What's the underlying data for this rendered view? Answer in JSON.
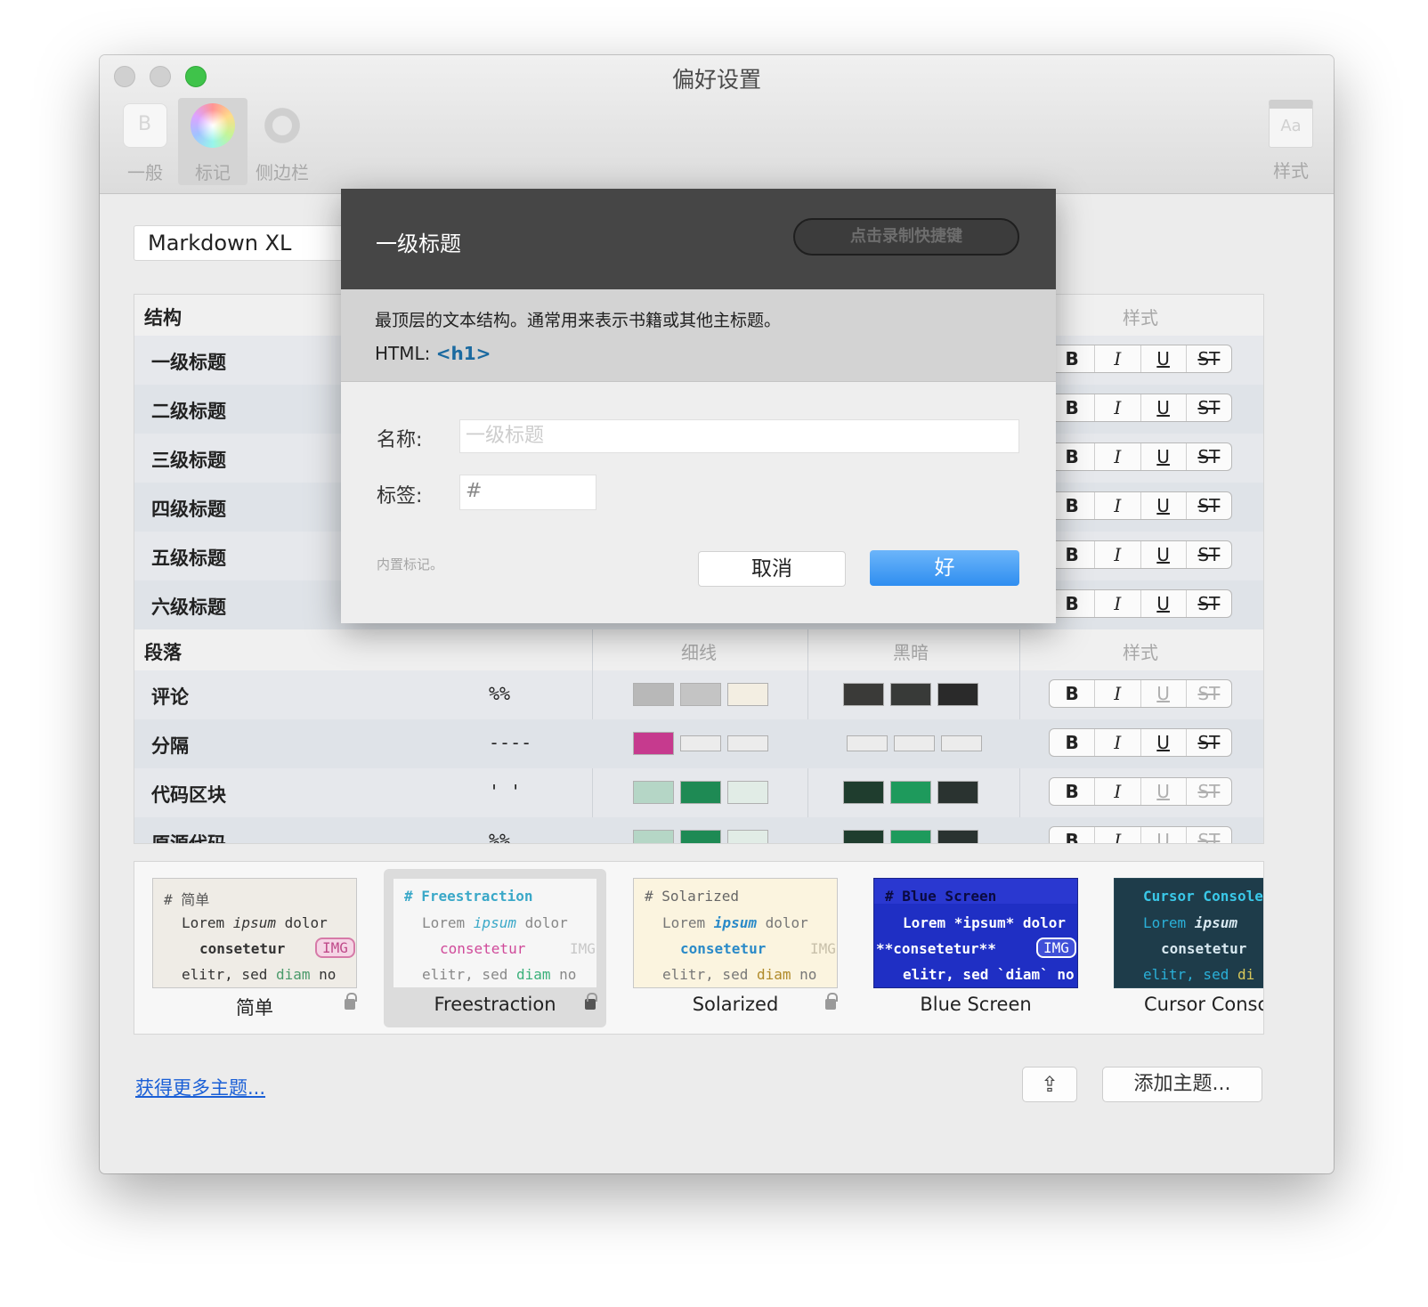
{
  "window": {
    "title": "偏好设置"
  },
  "toolbar": {
    "general": "一般",
    "marks": "标记",
    "sidebar": "侧边栏",
    "style": "样式",
    "style_icon_text": "Aa"
  },
  "theme_select": "Markdown XL",
  "grid": {
    "structure": {
      "label": "结构",
      "style_header": "样式"
    },
    "headings": [
      {
        "label": "一级标题",
        "fmt": [
          "B",
          "I",
          "U",
          "ST"
        ]
      },
      {
        "label": "二级标题",
        "fmt": [
          "B",
          "I",
          "U",
          "ST"
        ]
      },
      {
        "label": "三级标题",
        "fmt": [
          "B",
          "I",
          "U",
          "ST"
        ]
      },
      {
        "label": "四级标题",
        "fmt": [
          "B",
          "I",
          "U",
          "ST"
        ]
      },
      {
        "label": "五级标题",
        "fmt": [
          "B",
          "I",
          "U",
          "ST"
        ]
      },
      {
        "label": "六级标题",
        "fmt": [
          "B",
          "I",
          "U",
          "ST"
        ]
      }
    ],
    "paragraph": {
      "label": "段落",
      "light_header": "细线",
      "dark_header": "黑暗",
      "style_header": "样式"
    },
    "rows": [
      {
        "label": "评论",
        "tag": "%%",
        "light": [
          "#b8b8b8",
          "#c4c4c4",
          "#f3eee2"
        ],
        "dark": [
          "#3a3a38",
          "#383a38",
          "#2a2a2a"
        ],
        "fmt": [
          "B",
          "I",
          "U",
          "ST"
        ]
      },
      {
        "label": "分隔",
        "tag": "----",
        "light": [
          "#c63a8e",
          "#ececec",
          "#ececec"
        ],
        "dark": [
          "#ececec",
          "#ececec",
          "#ececec"
        ],
        "fmt": [
          "B",
          "I",
          "U",
          "ST"
        ]
      },
      {
        "label": "代码区块",
        "tag": "' '",
        "light": [
          "#b5d6c6",
          "#1e8a54",
          "#e1ece6"
        ],
        "dark": [
          "#1f3d2e",
          "#1e9a5c",
          "#2a3330"
        ],
        "fmt": [
          "B",
          "I",
          "U",
          "ST"
        ]
      },
      {
        "label": "原源代码",
        "tag": "%%",
        "light": [
          "#b5d6c6",
          "#1e8a54",
          "#e1ece6"
        ],
        "dark": [
          "#1f3d2e",
          "#1e9a5c",
          "#2a3330"
        ],
        "fmt": [
          "B",
          "I",
          "U",
          "ST"
        ]
      }
    ]
  },
  "themes": [
    {
      "name": "简单",
      "l1": "# 简单",
      "l2a": "Lorem ",
      "l2b": "ipsum",
      "l2c": " dolor",
      "l3": "consetetur",
      "img": "IMG",
      "l4a": "elitr, sed ",
      "l4b": "diam",
      "l4c": " no"
    },
    {
      "name": "Freestraction",
      "l1": "# Freestraction",
      "l2a": "Lorem ",
      "l2b": "ipsum",
      "l2c": " dolor",
      "l3": "consetetur",
      "img": "IMG",
      "l4a": "elitr, sed ",
      "l4b": "diam",
      "l4c": " no"
    },
    {
      "name": "Solarized",
      "l1": "# Solarized",
      "l2a": "Lorem ",
      "l2b": "ipsum",
      "l2c": " dolor",
      "l3": "consetetur",
      "img": "IMG",
      "l4a": "elitr, sed ",
      "l4b": "diam",
      "l4c": " no"
    },
    {
      "name": "Blue Screen",
      "l1": "# Blue Screen",
      "l2a": "Lorem *ipsum* dolor",
      "l3": "**consetetur**",
      "img": "IMG",
      "l4a": "elitr, sed `diam` no"
    },
    {
      "name": "Cursor Consc",
      "l1": "Cursor Console",
      "l2a": "Lorem ",
      "l2b": "ipsum",
      "l3": "consetetur",
      "l4a": "elitr, sed ",
      "l4b": "di"
    }
  ],
  "footer": {
    "more_link": "获得更多主题...",
    "share_icon": "⇪",
    "add_button": "添加主题..."
  },
  "sheet": {
    "title": "一级标题",
    "shortcut": "点击录制快捷键",
    "description": "最顶层的文本结构。通常用来表示书籍或其他主标题。",
    "html_label": "HTML: ",
    "html_tag": "<h1>",
    "name_label": "名称:",
    "name_placeholder": "一级标题",
    "tag_label": "标签:",
    "tag_value": "#",
    "builtin_note": "内置标记。",
    "cancel": "取消",
    "ok": "好"
  }
}
